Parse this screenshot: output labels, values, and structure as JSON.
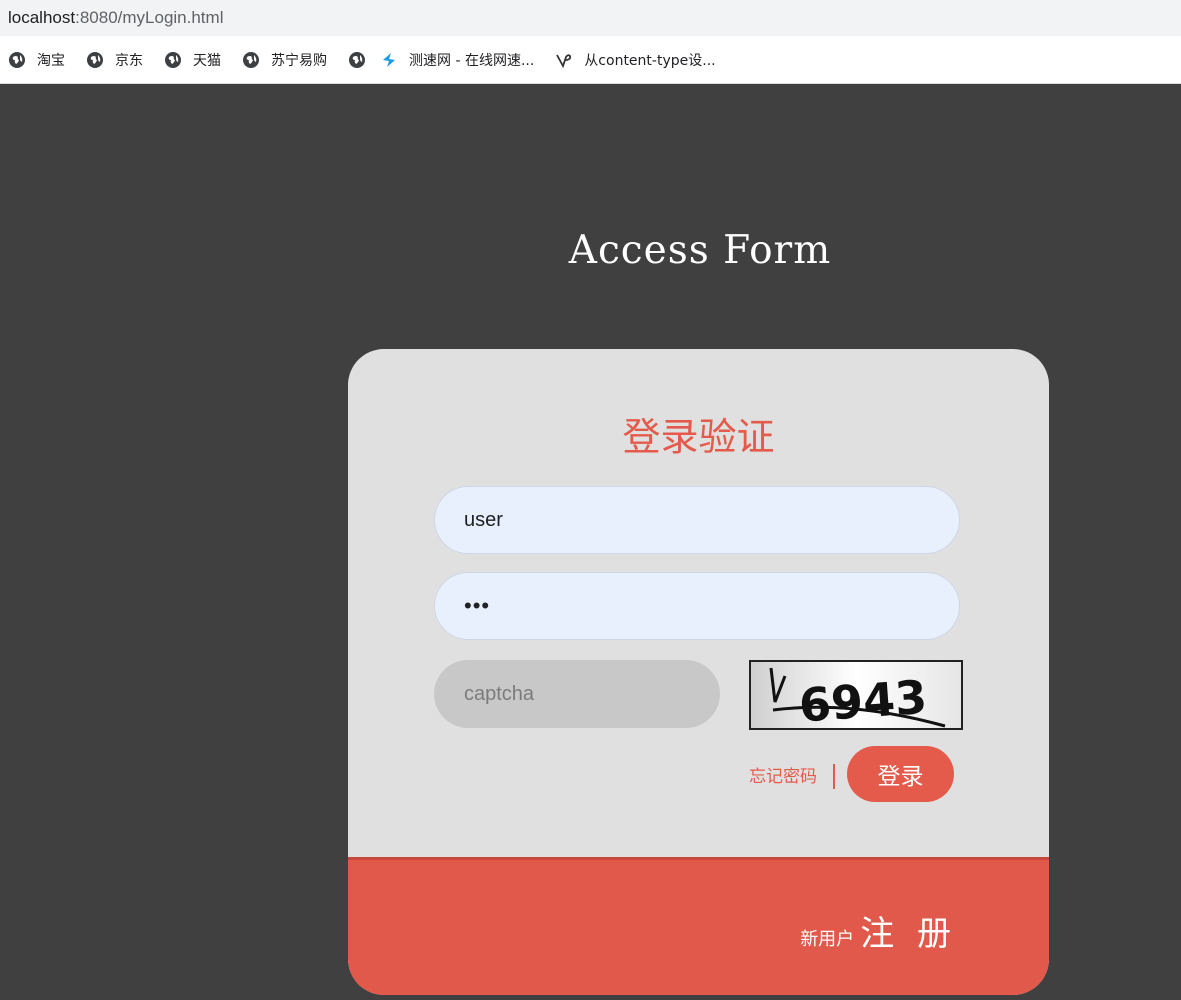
{
  "browser": {
    "url_host": "localhost",
    "url_rest": ":8080/myLogin.html",
    "bookmarks": [
      {
        "label": "淘宝",
        "icon": "globe-icon"
      },
      {
        "label": "京东",
        "icon": "globe-icon"
      },
      {
        "label": "天猫",
        "icon": "globe-icon"
      },
      {
        "label": "苏宁易购",
        "icon": "globe-icon"
      },
      {
        "label": "",
        "icon": "globe-icon"
      },
      {
        "label": "测速网 - 在线网速...",
        "icon": "speedtest-icon"
      },
      {
        "label": "从content-type设...",
        "icon": "bookmark-logo-icon"
      }
    ]
  },
  "page": {
    "title": "Access Form"
  },
  "login": {
    "heading": "登录验证",
    "username_value": "user",
    "password_display": "•••",
    "captcha_placeholder": "captcha",
    "captcha_text": "6943",
    "forgot_label": "忘记密码",
    "login_label": "登录"
  },
  "footer": {
    "new_user_label": "新用户",
    "register_label": "注 册"
  },
  "colors": {
    "accent": "#e45a4b",
    "page_bg": "#404040",
    "card_bg": "#e0e0e0",
    "input_bg": "#e8f0fe"
  }
}
